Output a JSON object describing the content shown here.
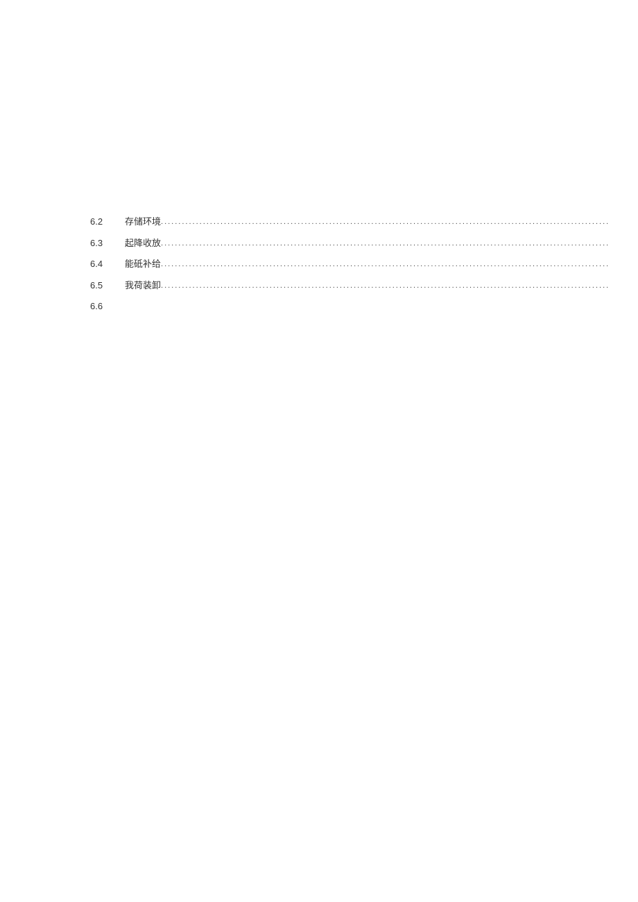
{
  "toc": {
    "entries": [
      {
        "number": "6.2",
        "title": "存储环境",
        "leader": true
      },
      {
        "number": "6.3",
        "title": "起降收放",
        "leader": true
      },
      {
        "number": "6.4",
        "title": "能砥补给",
        "leader": true
      },
      {
        "number": "6.5",
        "title": "我荷装卸",
        "leader": true
      },
      {
        "number": "6.6",
        "title": "",
        "leader": false
      }
    ]
  }
}
